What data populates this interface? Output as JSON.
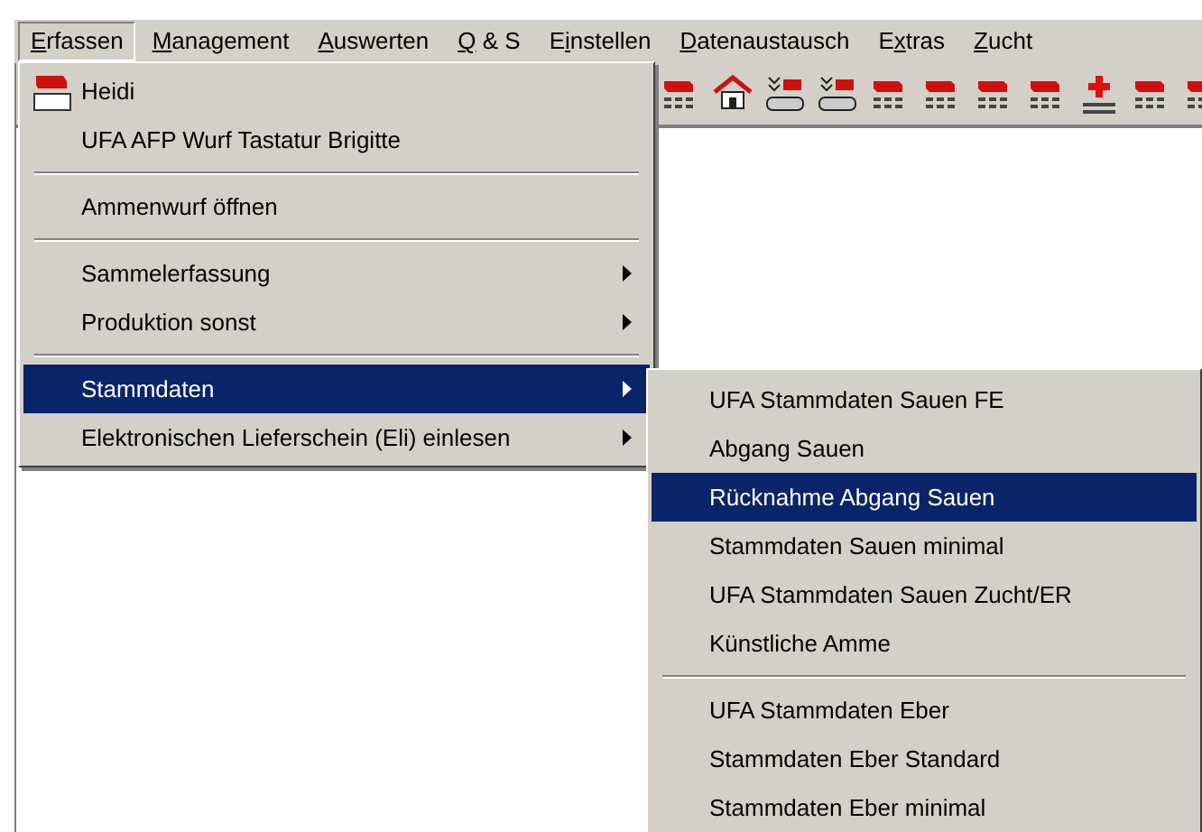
{
  "menu_bar": [
    {
      "key": "E",
      "after": "rfassen",
      "selected": true
    },
    {
      "key": "M",
      "after": "anagement",
      "selected": false
    },
    {
      "key": "A",
      "after": "uswerten",
      "selected": false
    },
    {
      "key": "Q",
      "after": " & S",
      "selected": false
    },
    {
      "before": "E",
      "key": "i",
      "after": "nstellen",
      "selected": false
    },
    {
      "key": "D",
      "after": "atenaustausch",
      "selected": false
    },
    {
      "before": "E",
      "key": "x",
      "after": "tras",
      "selected": false
    },
    {
      "key": "Z",
      "after": "ucht",
      "selected": false
    }
  ],
  "main_menu": {
    "items": [
      {
        "kind": "icon-item",
        "label": "Heidi",
        "has_submenu": false,
        "selected": false
      },
      {
        "kind": "item",
        "label": "UFA AFP Wurf Tastatur Brigitte",
        "has_submenu": false,
        "selected": false
      },
      {
        "kind": "separator"
      },
      {
        "kind": "item",
        "label": "Ammenwurf öffnen",
        "has_submenu": false,
        "selected": false
      },
      {
        "kind": "separator"
      },
      {
        "kind": "item",
        "label": "Sammelerfassung",
        "has_submenu": true,
        "selected": false
      },
      {
        "kind": "item",
        "label": "Produktion sonst",
        "has_submenu": true,
        "selected": false
      },
      {
        "kind": "separator"
      },
      {
        "kind": "item",
        "label": "Stammdaten",
        "has_submenu": true,
        "selected": true
      },
      {
        "kind": "item",
        "label": "Elektronischen Lieferschein (Eli) einlesen",
        "has_submenu": true,
        "selected": false
      }
    ]
  },
  "submenu": {
    "items": [
      {
        "kind": "item",
        "label": "UFA Stammdaten Sauen FE",
        "has_submenu": false,
        "selected": false
      },
      {
        "kind": "item",
        "label": "Abgang Sauen",
        "has_submenu": false,
        "selected": false
      },
      {
        "kind": "item",
        "label": "Rücknahme Abgang Sauen",
        "has_submenu": false,
        "selected": true
      },
      {
        "kind": "item",
        "label": "Stammdaten Sauen minimal",
        "has_submenu": false,
        "selected": false
      },
      {
        "kind": "item",
        "label": "UFA Stammdaten Sauen Zucht/ER",
        "has_submenu": false,
        "selected": false
      },
      {
        "kind": "item",
        "label": "Künstliche Amme",
        "has_submenu": false,
        "selected": false
      },
      {
        "kind": "separator"
      },
      {
        "kind": "item",
        "label": "UFA Stammdaten Eber",
        "has_submenu": false,
        "selected": false
      },
      {
        "kind": "item",
        "label": "Stammdaten Eber Standard",
        "has_submenu": false,
        "selected": false
      },
      {
        "kind": "item",
        "label": "Stammdaten Eber minimal",
        "has_submenu": false,
        "selected": false
      }
    ]
  }
}
